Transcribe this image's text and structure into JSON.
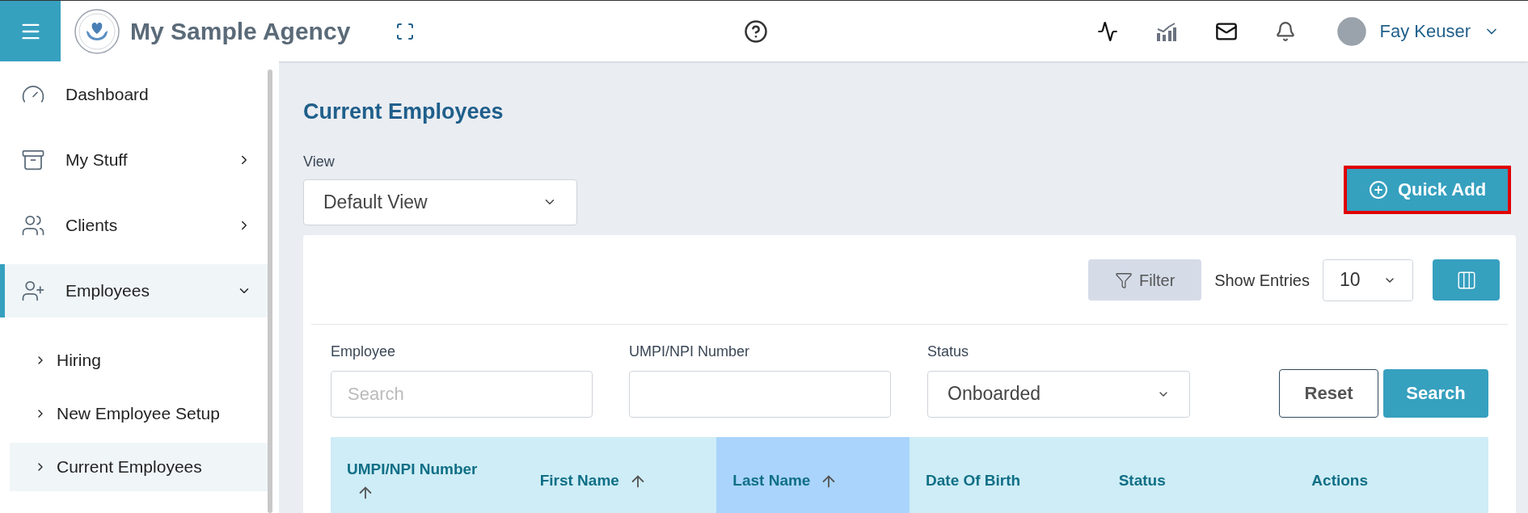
{
  "header": {
    "agency_name": "My Sample Agency",
    "user_name": "Fay Keuser"
  },
  "sidebar": {
    "items": [
      {
        "label": "Dashboard",
        "has_children": false,
        "expanded": false,
        "selected": false
      },
      {
        "label": "My Stuff",
        "has_children": true,
        "expanded": false,
        "selected": false
      },
      {
        "label": "Clients",
        "has_children": true,
        "expanded": false,
        "selected": false
      },
      {
        "label": "Employees",
        "has_children": true,
        "expanded": true,
        "selected": true,
        "children": [
          {
            "label": "Hiring",
            "selected": false
          },
          {
            "label": "New Employee Setup",
            "selected": false
          },
          {
            "label": "Current Employees",
            "selected": true
          }
        ]
      }
    ]
  },
  "page": {
    "title": "Current Employees",
    "view": {
      "label": "View",
      "value": "Default View"
    },
    "quick_add": {
      "label": "Quick Add",
      "highlighted": true
    }
  },
  "toolbar": {
    "filter": "Filter",
    "show_entries_label": "Show Entries",
    "show_entries_value": "10"
  },
  "search_form": {
    "fields": [
      {
        "kind": "text",
        "label": "Employee",
        "placeholder": "Search"
      },
      {
        "kind": "text",
        "label": "UMPI/NPI Number"
      },
      {
        "kind": "select",
        "label": "Status",
        "value": "Onboarded"
      }
    ],
    "reset": "Reset",
    "search": "Search"
  },
  "table": {
    "columns": [
      {
        "label": "UMPI/NPI Number",
        "sortable": true,
        "selected": false
      },
      {
        "label": "First Name",
        "sortable": true,
        "selected": false
      },
      {
        "label": "Last Name",
        "sortable": true,
        "selected": true
      },
      {
        "label": "Date Of Birth",
        "sortable": false,
        "selected": false
      },
      {
        "label": "Status",
        "sortable": false,
        "selected": false
      },
      {
        "label": "Actions",
        "sortable": false,
        "selected": false
      }
    ]
  }
}
